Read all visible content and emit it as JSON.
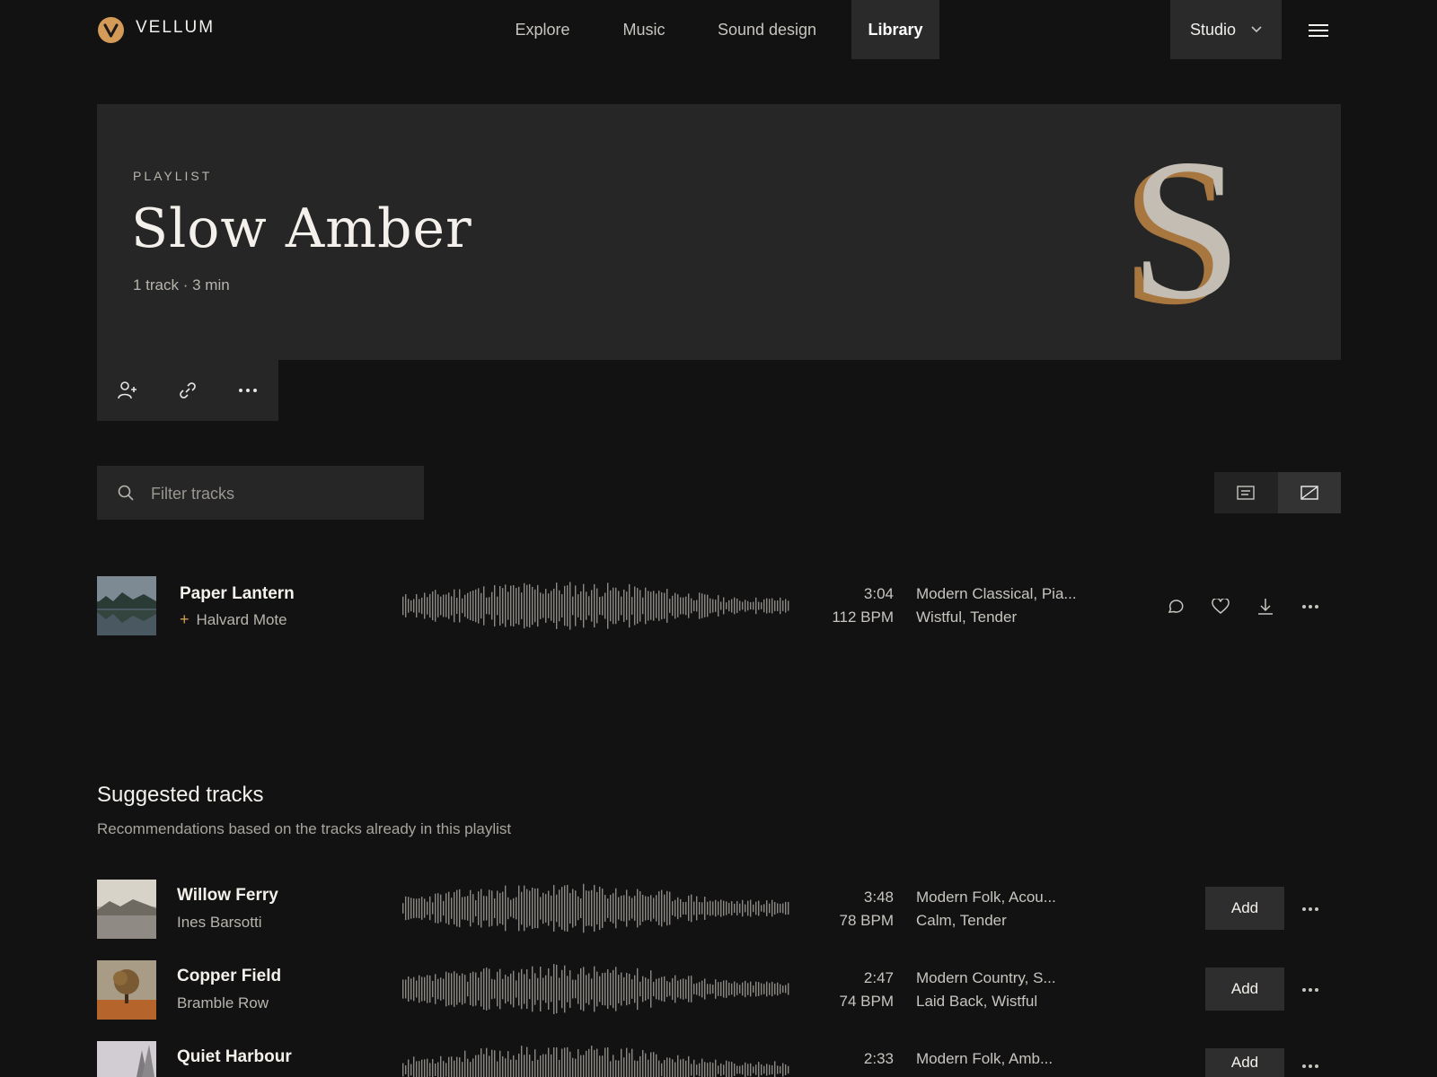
{
  "header": {
    "brand": "VELLUM",
    "nav": [
      "Explore",
      "Music",
      "Sound design",
      "Library"
    ],
    "active_nav": "Library",
    "studio_label": "Studio"
  },
  "hero": {
    "eyebrow": "PLAYLIST",
    "title": "Slow Amber",
    "meta": "1 track · 3 min",
    "monogram": "S"
  },
  "filter": {
    "placeholder": "Filter tracks"
  },
  "playlist_tracks": [
    {
      "title": "Paper Lantern",
      "artist": "Halvard Mote",
      "duration": "3:04",
      "bpm": "112 BPM",
      "genres": "Modern Classical, Pia...",
      "moods": "Wistful, Tender"
    }
  ],
  "suggested": {
    "title": "Suggested tracks",
    "subtitle": "Recommendations based on the tracks already in this playlist",
    "add_label": "Add",
    "tracks": [
      {
        "title": "Willow Ferry",
        "artist": "Ines Barsotti",
        "duration": "3:48",
        "bpm": "78 BPM",
        "genres": "Modern Folk, Acou...",
        "moods": "Calm, Tender"
      },
      {
        "title": "Copper Field",
        "artist": "Bramble Row",
        "duration": "2:47",
        "bpm": "74 BPM",
        "genres": "Modern Country, S...",
        "moods": "Laid Back, Wistful"
      },
      {
        "title": "Quiet Harbour",
        "artist": "",
        "duration": "2:33",
        "bpm": "",
        "genres": "Modern Folk, Amb...",
        "moods": ""
      }
    ]
  },
  "colors": {
    "accent": "#d49a58",
    "background": "#121212",
    "panel": "#262626"
  }
}
